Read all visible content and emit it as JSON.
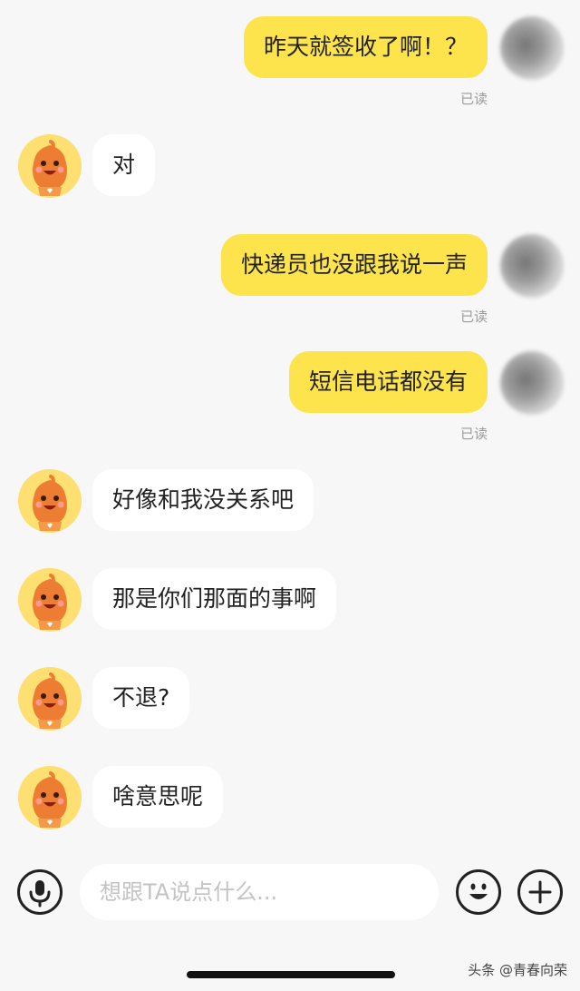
{
  "messages": [
    {
      "dir": "out",
      "text": "昨天就签收了啊！？",
      "status": "已读"
    },
    {
      "dir": "in",
      "text": "对"
    },
    {
      "dir": "out",
      "text": "快递员也没跟我说一声",
      "status": "已读"
    },
    {
      "dir": "out",
      "text": "短信电话都没有",
      "status": "已读"
    },
    {
      "dir": "in",
      "text": "好像和我没关系吧"
    },
    {
      "dir": "in",
      "text": "那是你们那面的事啊"
    },
    {
      "dir": "in",
      "text": "不退?"
    },
    {
      "dir": "in",
      "text": "啥意思呢"
    }
  ],
  "input": {
    "placeholder": "想跟TA说点什么..."
  },
  "icons": {
    "voice": "microphone-icon",
    "emoji": "smiley-icon",
    "more": "plus-icon"
  },
  "colors": {
    "outgoing_bubble": "#fde44d",
    "incoming_bubble": "#ffffff",
    "background": "#f7f7f7"
  },
  "watermark": "头条 @青春向荣"
}
